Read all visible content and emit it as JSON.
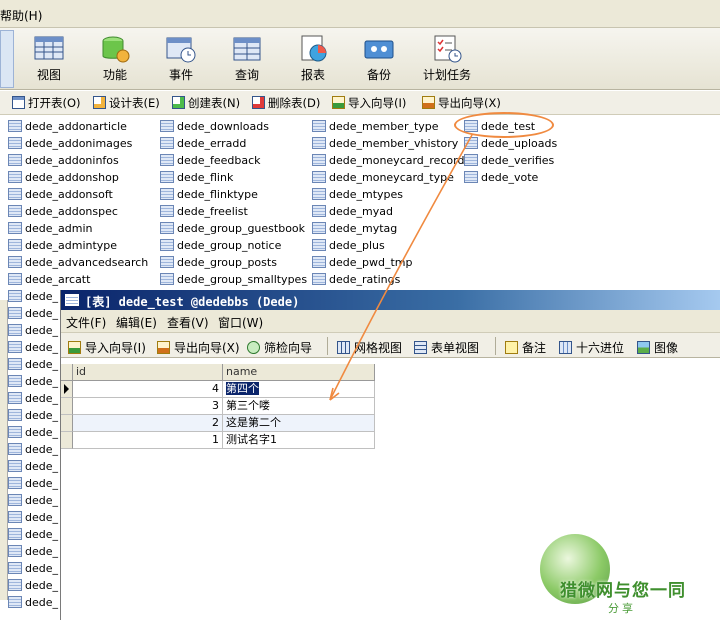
{
  "menubar": {
    "help_label": "帮助(H)"
  },
  "toolbar_big": [
    {
      "label": "视图",
      "icon": "view-icon"
    },
    {
      "label": "功能",
      "icon": "function-icon"
    },
    {
      "label": "事件",
      "icon": "event-icon"
    },
    {
      "label": "查询",
      "icon": "query-icon"
    },
    {
      "label": "报表",
      "icon": "report-icon"
    },
    {
      "label": "备份",
      "icon": "backup-icon"
    },
    {
      "label": "计划任务",
      "icon": "schedule-icon"
    }
  ],
  "toolbar_sub": [
    {
      "label": "打开表(O)",
      "icon": "open-table-icon"
    },
    {
      "label": "设计表(E)",
      "icon": "design-table-icon"
    },
    {
      "label": "创建表(N)",
      "icon": "create-table-icon"
    },
    {
      "label": "删除表(D)",
      "icon": "delete-table-icon"
    },
    {
      "label": "导入向导(I)",
      "icon": "import-icon"
    },
    {
      "label": "导出向导(X)",
      "icon": "export-icon"
    }
  ],
  "tables": {
    "col1": [
      "dede_addonarticle",
      "dede_addonimages",
      "dede_addoninfos",
      "dede_addonshop",
      "dede_addonsoft",
      "dede_addonspec",
      "dede_admin",
      "dede_admintype",
      "dede_advancedsearch",
      "dede_arcatt"
    ],
    "col2": [
      "dede_downloads",
      "dede_erradd",
      "dede_feedback",
      "dede_flink",
      "dede_flinktype",
      "dede_freelist",
      "dede_group_guestbook",
      "dede_group_notice",
      "dede_group_posts",
      "dede_group_smalltypes"
    ],
    "col3": [
      "dede_member_type",
      "dede_member_vhistory",
      "dede_moneycard_record",
      "dede_moneycard_type",
      "dede_mtypes",
      "dede_myad",
      "dede_mytag",
      "dede_plus",
      "dede_pwd_tmp",
      "dede_ratings"
    ],
    "col4": [
      "dede_test",
      "dede_uploads",
      "dede_verifies",
      "dede_vote"
    ],
    "truncated_label": "dede_"
  },
  "table_window": {
    "title": "[表] dede_test @dedebbs (Dede)",
    "menu": [
      "文件(F)",
      "编辑(E)",
      "查看(V)",
      "窗口(W)"
    ],
    "tools": [
      {
        "label": "导入向导(I)",
        "icon": "import-icon"
      },
      {
        "label": "导出向导(X)",
        "icon": "export-icon"
      },
      {
        "label": "筛检向导",
        "icon": "filter-wizard-icon"
      },
      {
        "label": "网格视图",
        "icon": "grid-view-icon"
      },
      {
        "label": "表单视图",
        "icon": "form-view-icon"
      },
      {
        "label": "备注",
        "icon": "memo-icon"
      },
      {
        "label": "十六进位",
        "icon": "hex-icon"
      },
      {
        "label": "图像",
        "icon": "image-icon"
      }
    ],
    "columns": [
      "id",
      "name"
    ],
    "rows": [
      {
        "id": "4",
        "name": "第四个"
      },
      {
        "id": "3",
        "name": "第三个喽"
      },
      {
        "id": "2",
        "name": "这是第二个"
      },
      {
        "id": "1",
        "name": "测试名字1"
      }
    ]
  },
  "watermark": {
    "text": "猎微网与您一同",
    "sub": "分享"
  },
  "colors": {
    "title_bar": "#0a246a",
    "callout": "#f08a40",
    "selection": "#0a246a"
  }
}
